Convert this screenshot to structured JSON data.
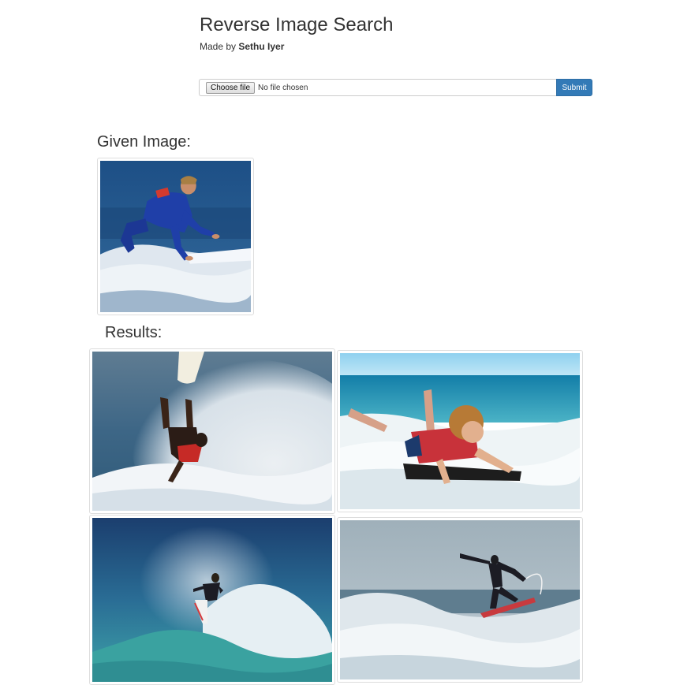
{
  "header": {
    "title": "Reverse Image Search",
    "author_prefix": "Made by ",
    "author_name": "Sethu Iyer"
  },
  "upload": {
    "choose_label": "Choose file",
    "file_status": "No file chosen",
    "submit_label": "Submit"
  },
  "given": {
    "heading": "Given Image:",
    "image": "surfer-blue-wetsuit-photo"
  },
  "results": {
    "heading": "Results:",
    "images": [
      "surfer-wipeout-splash-photo",
      "boy-bodyboarding-red-shirt-photo",
      "surfer-turning-wave-spray-photo",
      "surfer-aerial-red-board-photo"
    ]
  },
  "colors": {
    "submit_bg": "#337ab7",
    "thumbnail_border": "#dddddd",
    "text": "#333333"
  }
}
